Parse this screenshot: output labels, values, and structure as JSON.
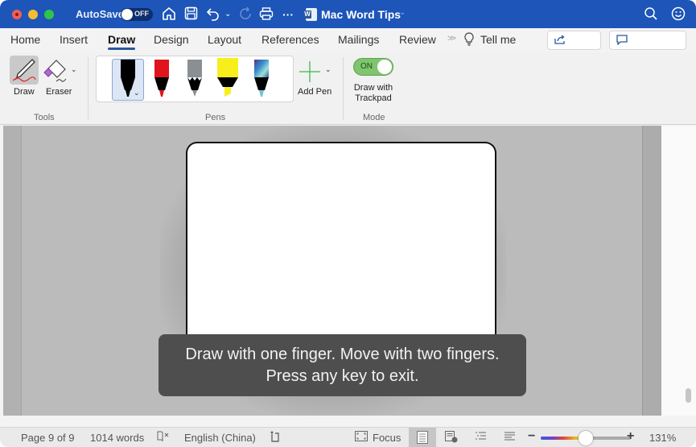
{
  "titlebar": {
    "autosave_label": "AutoSave",
    "autosave_state": "OFF",
    "document_title": "Mac Word Tips",
    "icons": [
      "home-icon",
      "save-icon",
      "undo-icon",
      "undo-dropdown-icon",
      "redo-icon",
      "print-icon",
      "more-icon",
      "search-icon",
      "feedback-smiley-icon"
    ]
  },
  "ribbon_tabs": {
    "tabs": [
      {
        "label": "Home",
        "active": false
      },
      {
        "label": "Insert",
        "active": false
      },
      {
        "label": "Draw",
        "active": true
      },
      {
        "label": "Design",
        "active": false
      },
      {
        "label": "Layout",
        "active": false
      },
      {
        "label": "References",
        "active": false
      },
      {
        "label": "Mailings",
        "active": false
      },
      {
        "label": "Review",
        "active": false
      }
    ],
    "tell_me": "Tell me",
    "share_label": "Share",
    "comments_label": "Comments",
    "accent_color": "#2b579a"
  },
  "ribbon": {
    "tools": {
      "group_label": "Tools",
      "draw_label": "Draw",
      "eraser_label": "Eraser"
    },
    "pens": {
      "group_label": "Pens",
      "items": [
        {
          "name": "black-pen",
          "color": "#000000",
          "selected": true
        },
        {
          "name": "red-pen",
          "color": "#e0141e",
          "selected": false
        },
        {
          "name": "gray-pencil",
          "color": "#8a8f94",
          "selected": false
        },
        {
          "name": "yellow-highlighter",
          "color": "#f6ef1c",
          "selected": false
        },
        {
          "name": "galaxy-pen",
          "color": "#3a6fb0",
          "selected": false
        }
      ],
      "add_pen_label": "Add Pen"
    },
    "mode": {
      "group_label": "Mode",
      "toggle_state": "ON",
      "toggle_label_line1": "Draw with",
      "toggle_label_line2": "Trackpad"
    }
  },
  "hint": {
    "line1": "Draw with one finger.  Move with two fingers.",
    "line2": "Press any key to exit."
  },
  "statusbar": {
    "page": "Page 9 of 9",
    "words": "1014 words",
    "language": "English (China)",
    "focus_label": "Focus",
    "zoom_percent": "131%",
    "zoom_slider_fraction": 0.5
  }
}
